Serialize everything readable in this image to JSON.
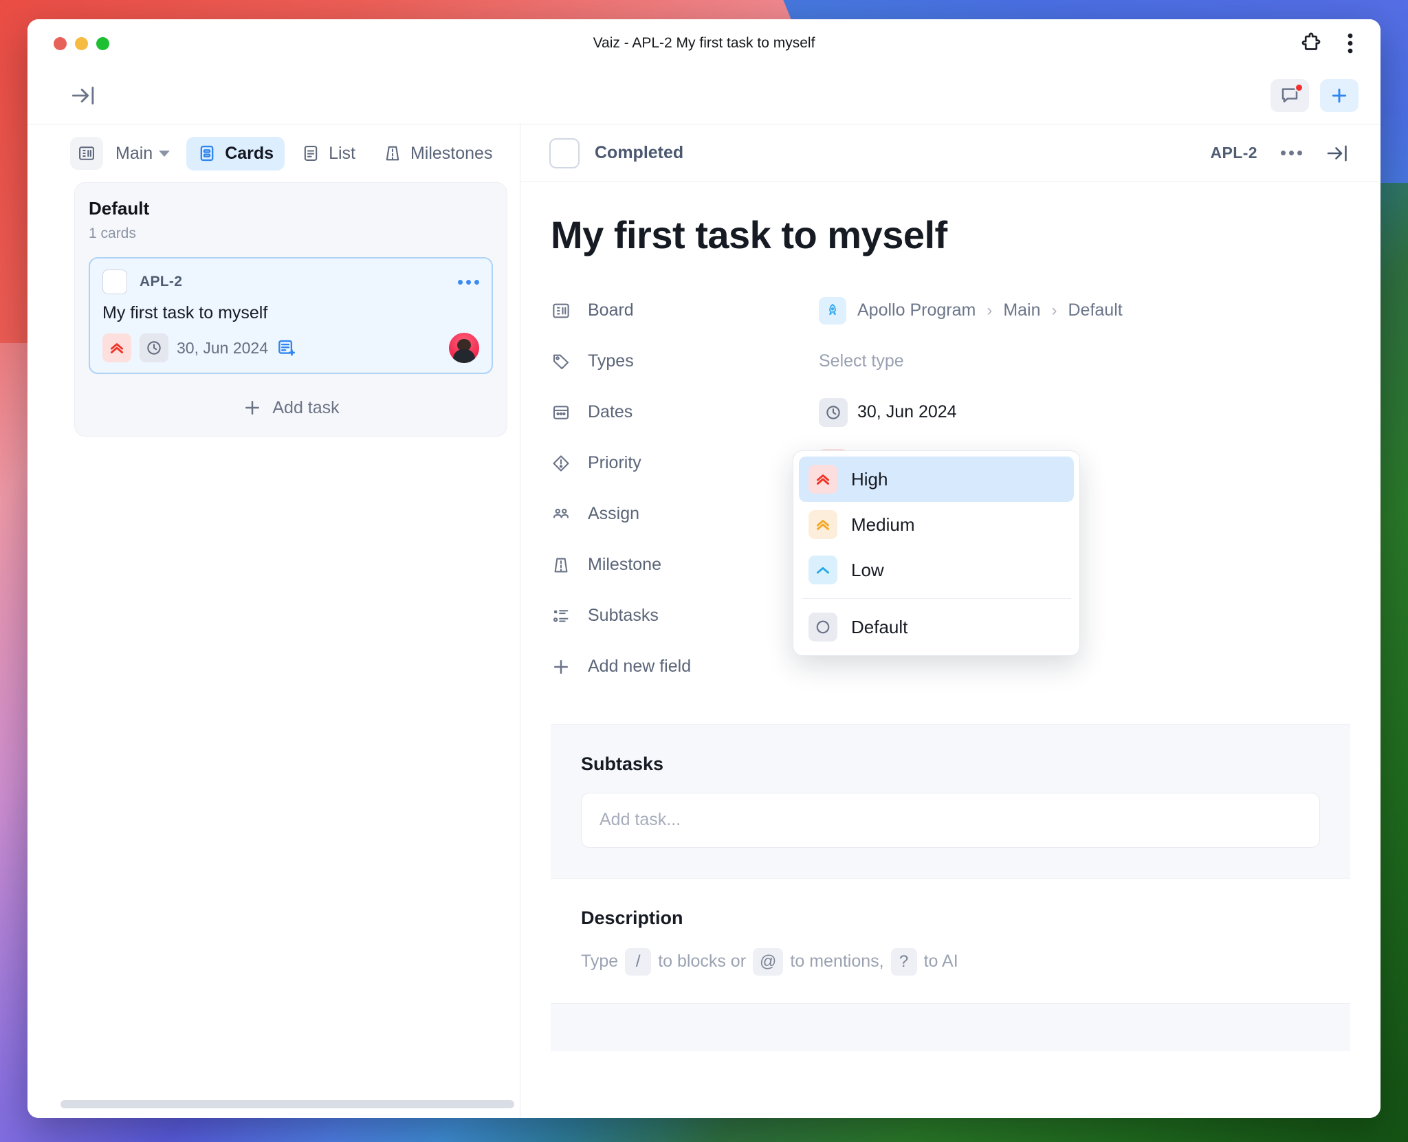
{
  "window": {
    "title": "Vaiz - APL-2 My first task to myself",
    "extensions_icon": "puzzle-icon",
    "menu_icon": "kebab-menu-icon"
  },
  "toolbar": {
    "collapse_icon": "collapse-sidebar-icon",
    "notifications_icon": "chat-bubble-icon",
    "add_icon": "plus-icon"
  },
  "viewtabs": {
    "board_icon": "board-icon",
    "selector_label": "Main",
    "items": [
      {
        "label": "Cards",
        "icon": "cards-icon",
        "active": true
      },
      {
        "label": "List",
        "icon": "list-icon",
        "active": false
      },
      {
        "label": "Milestones",
        "icon": "milestone-icon",
        "active": false
      }
    ]
  },
  "column": {
    "name": "Default",
    "count_label": "1 cards",
    "add_task_label": "Add task",
    "card": {
      "key": "APL-2",
      "title": "My first task to myself",
      "date": "30, Jun 2024",
      "priority": "High",
      "priority_icon": "priority-high-icon",
      "date_icon": "clock-icon",
      "subtask_icon": "add-subtask-icon",
      "more_icon": "more-dots-icon",
      "avatar_name": "assignee-avatar"
    }
  },
  "detail": {
    "completed_label": "Completed",
    "key": "APL-2",
    "more_icon": "more-dots-icon",
    "expand_icon": "collapse-panel-icon",
    "title": "My first task to myself",
    "fields": [
      {
        "label": "Board",
        "icon": "board-icon",
        "value_type": "breadcrumb",
        "breadcrumb": [
          "Apollo Program",
          "Main",
          "Default"
        ],
        "value_icon": "rocket-icon"
      },
      {
        "label": "Types",
        "icon": "tag-icon",
        "value_type": "placeholder",
        "value": "Select type"
      },
      {
        "label": "Dates",
        "icon": "calendar-icon",
        "value_type": "chip",
        "value": "30, Jun 2024",
        "value_icon": "clock-icon"
      },
      {
        "label": "Priority",
        "icon": "priority-icon",
        "value_type": "chip",
        "value": "High",
        "value_icon": "priority-high-icon"
      },
      {
        "label": "Assign",
        "icon": "people-icon",
        "value_type": "empty",
        "value": ""
      },
      {
        "label": "Milestone",
        "icon": "milestone-icon",
        "value_type": "empty",
        "value": ""
      },
      {
        "label": "Subtasks",
        "icon": "subtasks-icon",
        "value_type": "empty",
        "value": ""
      }
    ],
    "add_field_label": "Add new field",
    "add_field_icon": "plus-icon"
  },
  "priority_menu": {
    "options": [
      {
        "label": "High",
        "icon": "priority-high-icon",
        "selected": true
      },
      {
        "label": "Medium",
        "icon": "priority-medium-icon",
        "selected": false
      },
      {
        "label": "Low",
        "icon": "priority-low-icon",
        "selected": false
      },
      {
        "label": "Default",
        "icon": "priority-default-icon",
        "selected": false
      }
    ]
  },
  "subtasks": {
    "heading": "Subtasks",
    "input_placeholder": "Add task..."
  },
  "description": {
    "heading": "Description",
    "hint_parts": [
      "Type",
      "/",
      "to blocks or",
      "@",
      "to mentions,",
      "?",
      "to AI"
    ]
  },
  "colors": {
    "accent_blue": "#3d8bf0",
    "priority_high": "#f03226",
    "priority_medium": "#f5a623",
    "priority_low": "#22a8e8",
    "active_tab_bg": "#ddeeff",
    "card_bg": "#eef6ff",
    "notification_dot": "#f03030"
  }
}
